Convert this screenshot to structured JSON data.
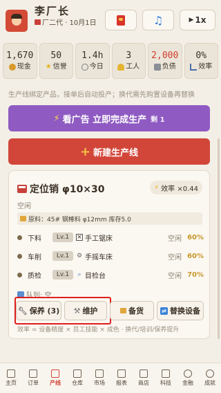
{
  "header": {
    "name": "李厂长",
    "subtitle": "厂二代 · 10月1日",
    "buttons": {
      "speed": "1x"
    }
  },
  "stats": [
    {
      "value": "1,670",
      "label": "现金",
      "color": "#3b3126"
    },
    {
      "value": "50",
      "label": "信誉",
      "color": "#3b3126"
    },
    {
      "value": "1.4h",
      "label": "今日",
      "color": "#3b3126"
    },
    {
      "value": "3",
      "label": "工人",
      "color": "#3b3126"
    },
    {
      "value": "2,000",
      "label": "负债",
      "color": "#d23b2b"
    },
    {
      "value": "0%",
      "label": "效率",
      "color": "#3b3126"
    }
  ],
  "hint": "生产线绑定产品，接单后自动投产；换代需先购置设备再替换",
  "ad_button": {
    "label": "看广告 立即完成生产",
    "remaining": "剩 1"
  },
  "new_line_button": {
    "label": "新建生产线"
  },
  "line_card": {
    "title": "定位销 φ10×30",
    "efficiency": "效率 ×0.44",
    "status": "空闲",
    "material": "原料：45# 钢棒料 φ12mm 库存5.0",
    "stages": [
      {
        "stage": "下料",
        "level": "Lv.1",
        "tool": "手工锯床",
        "state": "空闲",
        "pct": "60%"
      },
      {
        "stage": "车削",
        "level": "Lv.1",
        "tool": "手摇车床",
        "state": "空闲",
        "pct": "60%"
      },
      {
        "stage": "质检",
        "level": "Lv.1",
        "tool": "目检台",
        "state": "空闲",
        "pct": "70%"
      }
    ],
    "queue": "队列: 空",
    "actions": {
      "maintain": "保养 (3)",
      "repair": "维护",
      "stock": "备货",
      "replace": "替换设备"
    },
    "footer": "效率 = 设备精度 × 员工技能 × 成色 · 换代/培训/保养提升"
  },
  "tabs": [
    {
      "label": "主页",
      "active": false
    },
    {
      "label": "订单",
      "active": false
    },
    {
      "label": "产线",
      "active": true
    },
    {
      "label": "仓库",
      "active": false
    },
    {
      "label": "市场",
      "active": false
    },
    {
      "label": "报表",
      "active": false
    },
    {
      "label": "商店",
      "active": false
    },
    {
      "label": "科技",
      "active": false
    },
    {
      "label": "金融",
      "active": false
    },
    {
      "label": "成就",
      "active": false
    }
  ],
  "colors": {
    "accent_red": "#d2463a",
    "ad_purple": "#8f5bc2",
    "gold": "#c9982a"
  }
}
